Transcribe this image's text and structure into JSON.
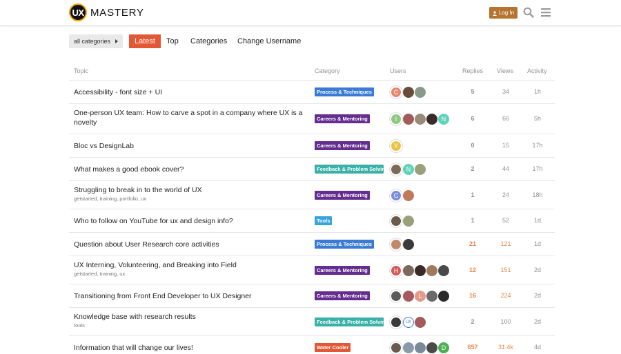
{
  "header": {
    "logo_badge": "UX",
    "logo_text": "MASTERY",
    "login_label": "Log In"
  },
  "nav": {
    "category_dropdown": "all categories",
    "items": [
      "Latest",
      "Top",
      "Categories",
      "Change Username"
    ]
  },
  "table": {
    "columns": [
      "Topic",
      "Category",
      "Users",
      "Replies",
      "Views",
      "Activity"
    ],
    "rows": [
      {
        "title": "Accessibility - font size + UI",
        "tags": "",
        "category": "Process & Techniques",
        "cat_color": "#3a7bd5",
        "users": [
          {
            "letter": "C",
            "color": "#e4886f"
          },
          {
            "letter": "",
            "color": "#6a4c3a"
          },
          {
            "letter": "",
            "color": "#8a9a8a"
          }
        ],
        "replies": "5",
        "views": "34",
        "activity": "1h"
      },
      {
        "title": "One-person UX team: How to carve a spot in a company where UX is a novelty",
        "tags": "",
        "category": "Careers & Mentoring",
        "cat_color": "#652d90",
        "users": [
          {
            "letter": "I",
            "color": "#8fc97f"
          },
          {
            "letter": "",
            "color": "#a45a5a"
          },
          {
            "letter": "",
            "color": "#9a8a7a"
          },
          {
            "letter": "",
            "color": "#3a2a2a"
          },
          {
            "letter": "N",
            "color": "#5fd3b8"
          }
        ],
        "replies": "6",
        "views": "66",
        "activity": "5h"
      },
      {
        "title": "Bloc vs DesignLab",
        "tags": "",
        "category": "Careers & Mentoring",
        "cat_color": "#652d90",
        "users": [
          {
            "letter": "Y",
            "color": "#e8c547"
          }
        ],
        "replies": "0",
        "views": "15",
        "activity": "17h"
      },
      {
        "title": "What makes a good ebook cover?",
        "tags": "",
        "category": "Feedback & Problem Solving",
        "cat_color": "#3ab1a8",
        "users": [
          {
            "letter": "",
            "color": "#7a6a5a"
          },
          {
            "letter": "N",
            "color": "#5fd3b8"
          },
          {
            "letter": "",
            "color": "#9aa07a"
          }
        ],
        "replies": "2",
        "views": "44",
        "activity": "17h"
      },
      {
        "title": "Struggling to break in to the world of UX",
        "tags": "getstarted, training, portfolio, ux",
        "category": "Careers & Mentoring",
        "cat_color": "#652d90",
        "users": [
          {
            "letter": "C",
            "color": "#7b8fd8"
          },
          {
            "letter": "",
            "color": "#c07a5a"
          }
        ],
        "replies": "1",
        "views": "24",
        "activity": "18h"
      },
      {
        "title": "Who to follow on YouTube for ux and design info?",
        "tags": "",
        "category": "Tools",
        "cat_color": "#3aa3dd",
        "users": [
          {
            "letter": "",
            "color": "#6a5a4a"
          },
          {
            "letter": "",
            "color": "#9aa07a"
          }
        ],
        "replies": "1",
        "views": "52",
        "activity": "1d"
      },
      {
        "title": "Question about User Research core activities",
        "tags": "",
        "category": "Process & Techniques",
        "cat_color": "#3a7bd5",
        "users": [
          {
            "letter": "",
            "color": "#c08a6a"
          },
          {
            "letter": "",
            "color": "#3a3a3a"
          }
        ],
        "replies": "21",
        "views": "121",
        "activity": "1d"
      },
      {
        "title": "UX Interning, Volunteering, and Breaking into Field",
        "tags": "getstarted, training, ux",
        "category": "Careers & Mentoring",
        "cat_color": "#652d90",
        "users": [
          {
            "letter": "H",
            "color": "#d45a5a"
          },
          {
            "letter": "",
            "color": "#7a6a5a"
          },
          {
            "letter": "",
            "color": "#3a2a2a"
          },
          {
            "letter": "",
            "color": "#a07a5a"
          },
          {
            "letter": "",
            "color": "#4a4a4a"
          }
        ],
        "replies": "12",
        "views": "151",
        "activity": "2d"
      },
      {
        "title": "Transitioning from Front End Developer to UX Designer",
        "tags": "",
        "category": "Careers & Mentoring",
        "cat_color": "#652d90",
        "users": [
          {
            "letter": "",
            "color": "#5a5a5a"
          },
          {
            "letter": "",
            "color": "#a45a5a"
          },
          {
            "letter": "L",
            "color": "#e49a8a"
          },
          {
            "letter": "",
            "color": "#6a6a6a"
          },
          {
            "letter": "",
            "color": "#2a2a2a"
          }
        ],
        "replies": "16",
        "views": "224",
        "activity": "2d"
      },
      {
        "title": "Knowledge base with research results",
        "tags": "tools",
        "category": "Feedback & Problem Solving",
        "cat_color": "#3ab1a8",
        "users": [
          {
            "letter": "",
            "color": "#3a3a3a"
          },
          {
            "letter": "UX",
            "color": "#3a7bd5"
          },
          {
            "letter": "",
            "color": "#a45a5a"
          }
        ],
        "replies": "2",
        "views": "100",
        "activity": "2d"
      },
      {
        "title": "Information that will change our lives!",
        "tags": "",
        "category": "Water Cooler",
        "cat_color": "#e45735",
        "users": [
          {
            "letter": "",
            "color": "#6a5a4a"
          },
          {
            "letter": "",
            "color": "#8a9aaa"
          },
          {
            "letter": "",
            "color": "#7a8a9a"
          },
          {
            "letter": "",
            "color": "#4a4a4a"
          },
          {
            "letter": "D",
            "color": "#4caf50"
          }
        ],
        "replies": "657",
        "views": "31.4k",
        "activity": "4d"
      }
    ]
  }
}
